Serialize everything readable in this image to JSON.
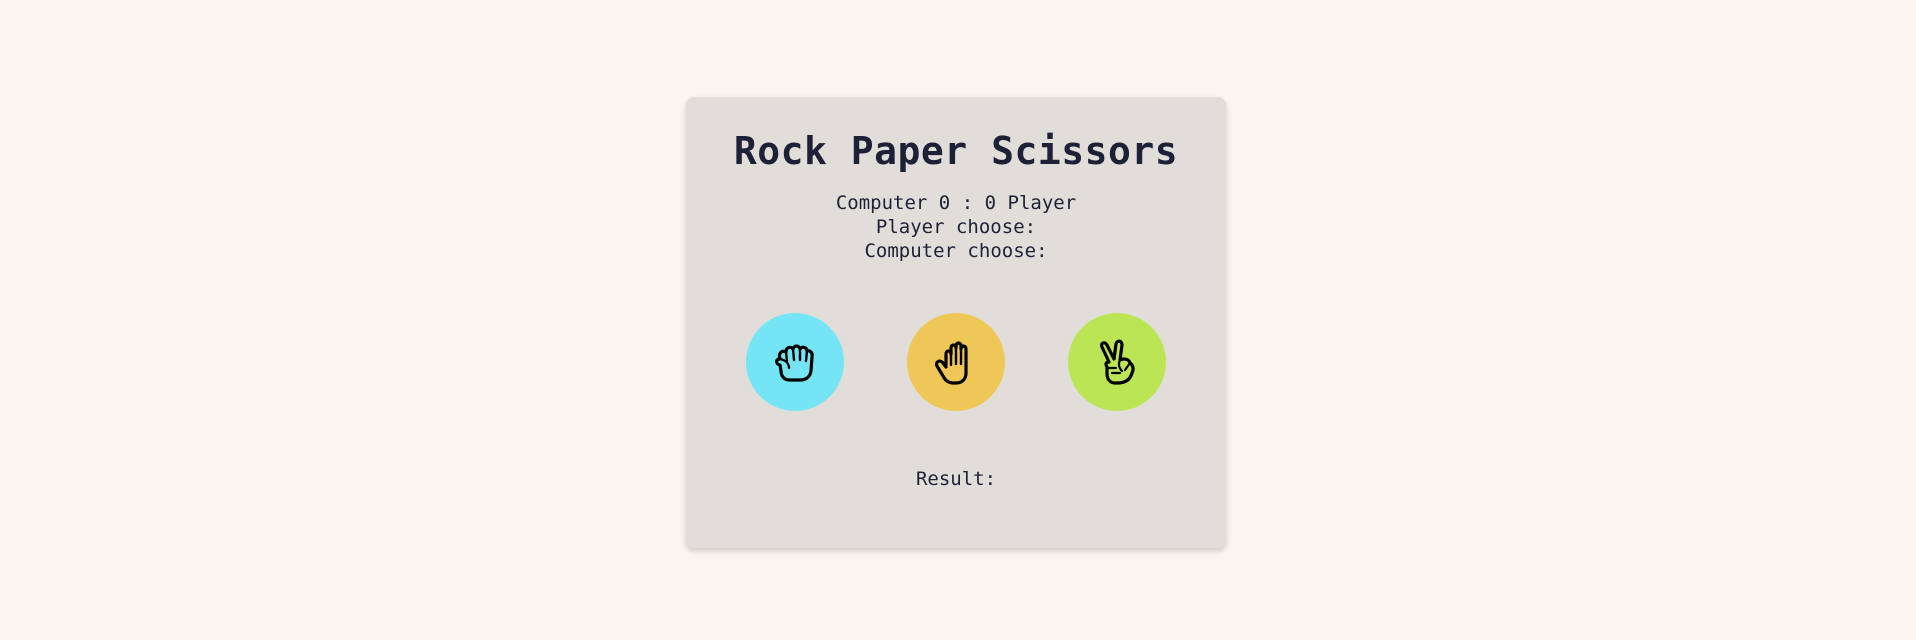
{
  "game": {
    "title": "Rock Paper Scissors",
    "computer_label": "Computer",
    "computer_score": "0",
    "separator": ":",
    "player_score": "0",
    "player_label": "Player",
    "player_choose_label": "Player choose:",
    "computer_choose_label": "Computer choose:",
    "result_label": "Result:"
  },
  "choices": [
    {
      "name": "rock",
      "icon": "fist-icon",
      "color": "#75e5f5"
    },
    {
      "name": "paper",
      "icon": "open-hand-icon",
      "color": "#efc756"
    },
    {
      "name": "scissors",
      "icon": "peace-sign-icon",
      "color": "#bce556"
    }
  ]
}
